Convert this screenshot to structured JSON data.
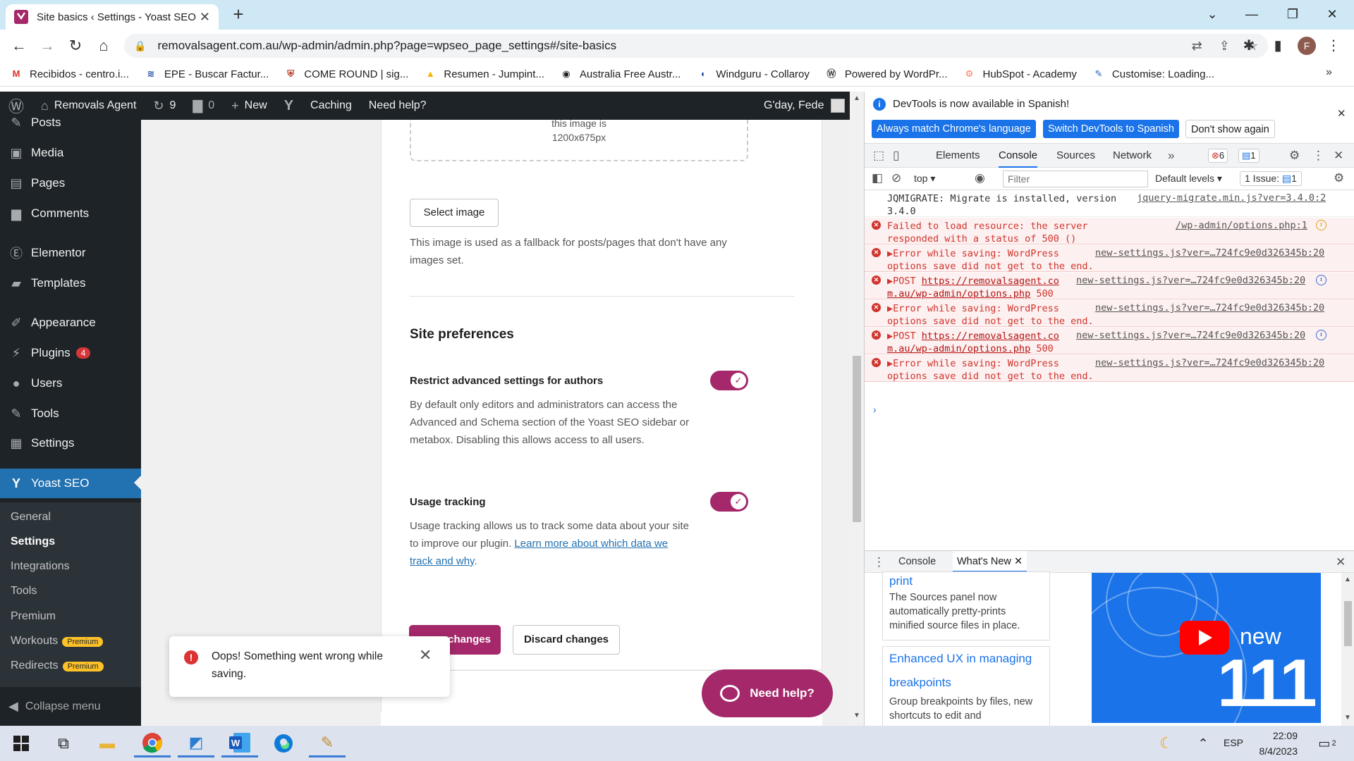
{
  "browser": {
    "tab_title": "Site basics ‹ Settings - Yoast SEO",
    "url": "removalsagent.com.au/wp-admin/admin.php?page=wpseo_page_settings#/site-basics",
    "profile_initial": "F"
  },
  "bookmarks": [
    {
      "label": "Recibidos - centro.i...",
      "icon": "gmail-icon"
    },
    {
      "label": "EPE - Buscar Factur...",
      "icon": "epe-icon"
    },
    {
      "label": "COME ROUND | sig...",
      "icon": "shield-icon"
    },
    {
      "label": "Resumen - Jumpint...",
      "icon": "drive-icon"
    },
    {
      "label": "Australia Free Austr...",
      "icon": "globe-icon"
    },
    {
      "label": "Windguru - Collaroy",
      "icon": "wave-icon"
    },
    {
      "label": "Powered by WordPr...",
      "icon": "wordpress-icon"
    },
    {
      "label": "HubSpot - Academy",
      "icon": "hubspot-icon"
    },
    {
      "label": "Customise: Loading...",
      "icon": "customise-icon"
    }
  ],
  "adminbar": {
    "site_name": "Removals Agent",
    "updates": "9",
    "comments": "0",
    "new": "New",
    "caching": "Caching",
    "help": "Need help?",
    "greeting": "G'day, Fede"
  },
  "sidebar": {
    "items": [
      {
        "label": "Posts"
      },
      {
        "label": "Media"
      },
      {
        "label": "Pages"
      },
      {
        "label": "Comments"
      },
      {
        "label": "Elementor"
      },
      {
        "label": "Templates"
      },
      {
        "label": "Appearance"
      },
      {
        "label": "Plugins",
        "badge": "4"
      },
      {
        "label": "Users"
      },
      {
        "label": "Tools"
      },
      {
        "label": "Settings"
      },
      {
        "label": "Yoast SEO"
      }
    ],
    "submenu": [
      {
        "label": "General"
      },
      {
        "label": "Settings"
      },
      {
        "label": "Integrations"
      },
      {
        "label": "Tools"
      },
      {
        "label": "Premium"
      },
      {
        "label": "Workouts",
        "badge": "Premium"
      },
      {
        "label": "Redirects",
        "badge": "Premium"
      }
    ],
    "collapse": "Collapse menu"
  },
  "main": {
    "image_note_1": "this image is",
    "image_note_2": "1200x675px",
    "select_image": "Select image",
    "fallback_desc": "This image is used as a fallback for posts/pages that don't have any images set.",
    "section_title": "Site preferences",
    "restrict_label": "Restrict advanced settings for authors",
    "restrict_desc": "By default only editors and administrators can access the Advanced and Schema section of the Yoast SEO sidebar or metabox. Disabling this allows access to all users.",
    "tracking_label": "Usage tracking",
    "tracking_desc": "Usage tracking allows us to track some data about your site to improve our plugin.",
    "tracking_link": "Learn more about which data we track and why",
    "save": "changes",
    "discard": "Discard changes",
    "toast": "Oops! Something went wrong while saving.",
    "need_help": "Need help?"
  },
  "devtools": {
    "info": "DevTools is now available in Spanish!",
    "btn_match": "Always match Chrome's language",
    "btn_switch": "Switch DevTools to Spanish",
    "btn_dont": "Don't show again",
    "tabs": [
      "Elements",
      "Console",
      "Sources",
      "Network"
    ],
    "error_count": "6",
    "msg_count": "1",
    "context": "top",
    "filter_placeholder": "Filter",
    "levels": "Default levels",
    "issues": "1 Issue:",
    "issues_count": "1",
    "logs": [
      {
        "msg": "JQMIGRATE: Migrate is installed, version 3.4.0",
        "src": "jquery-migrate.min.js?ver=3.4.0:2"
      },
      {
        "msg": "Failed to load resource: the server responded with a status of 500 ()",
        "src": "/wp-admin/options.php:1"
      },
      {
        "msg": "Error while saving: WordPress options save did not get to the end.",
        "src": "new-settings.js?ver=…724fc9e0d326345b:20"
      },
      {
        "msg_prefix": "POST",
        "msg_link": "https://removalsagent.com.au/wp-admin/options.php",
        "msg_suffix": "500",
        "src": "new-settings.js?ver=…724fc9e0d326345b:20"
      },
      {
        "msg": "Error while saving: WordPress options save did not get to the end.",
        "src": "new-settings.js?ver=…724fc9e0d326345b:20"
      },
      {
        "msg_prefix": "POST",
        "msg_link": "https://removalsagent.com.au/wp-admin/options.php",
        "msg_suffix": "500",
        "src": "new-settings.js?ver=…724fc9e0d326345b:20"
      },
      {
        "msg": "Error while saving: WordPress options save did not get to the end.",
        "src": "new-settings.js?ver=…724fc9e0d326345b:20"
      }
    ],
    "drawer_tabs": [
      "Console",
      "What's New"
    ],
    "whatsnew": {
      "card1_title": "print",
      "card1_text": "The Sources panel now automatically pretty-prints minified source files in place.",
      "card2_title": "Enhanced UX in managing breakpoints",
      "card2_text": "Group breakpoints by files, new shortcuts to edit and",
      "video_new": "new",
      "video_num": "111"
    }
  },
  "taskbar": {
    "lang": "ESP",
    "time": "22:09",
    "date": "8/4/2023",
    "notif": "2"
  }
}
